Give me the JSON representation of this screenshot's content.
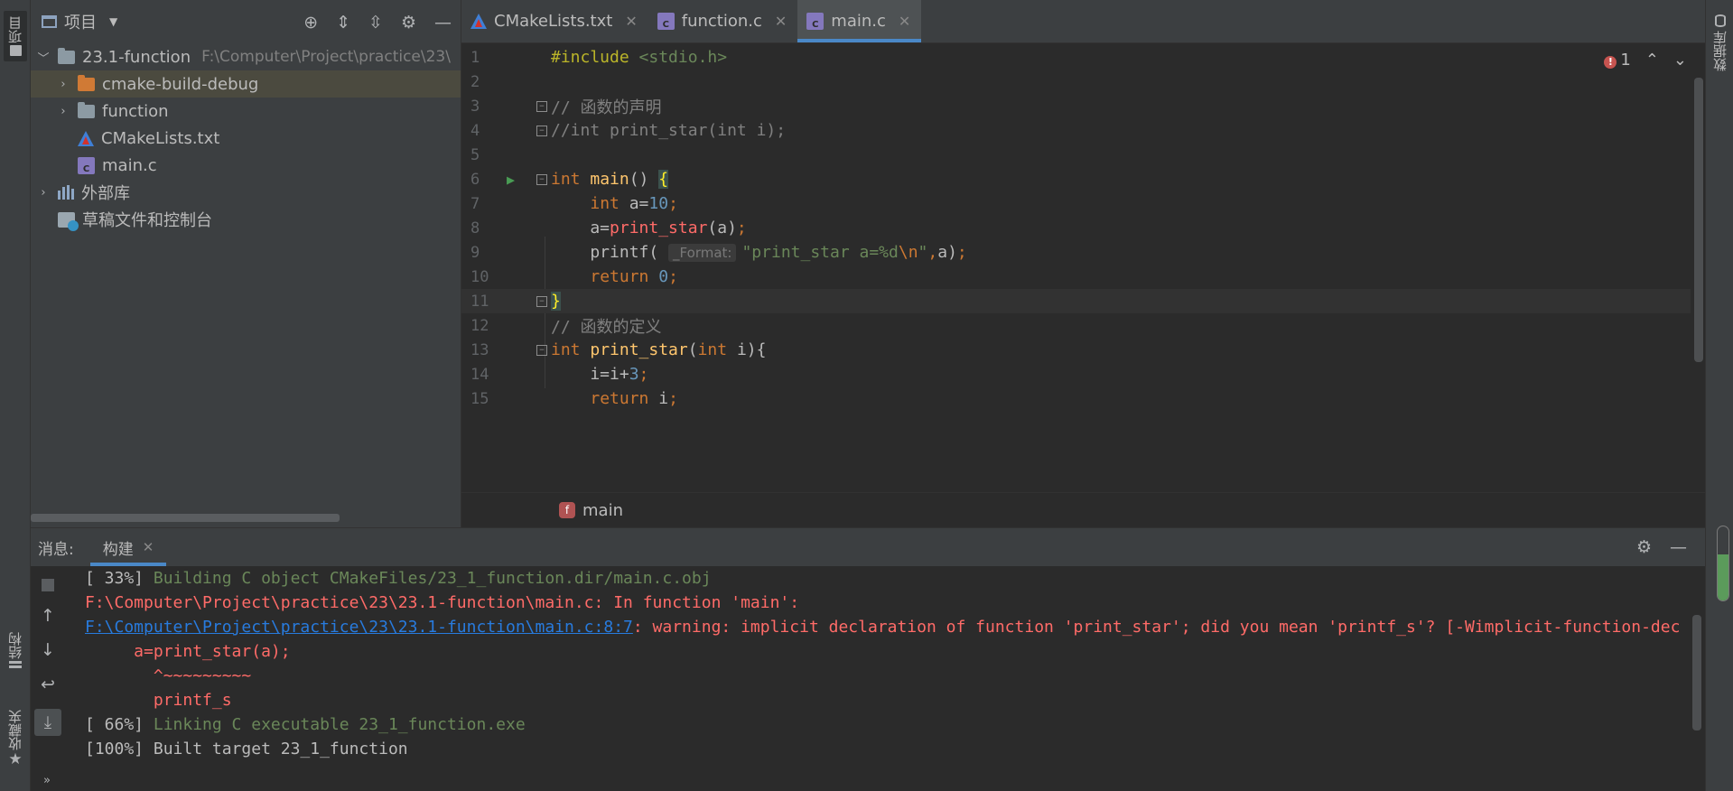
{
  "left_strip": {
    "project_tab": "项目",
    "structure_tab": "结构",
    "favorites_tab": "收藏夹"
  },
  "right_strip": {
    "database_tab": "数据库"
  },
  "project_panel": {
    "title": "项目",
    "tree": [
      {
        "label": "23.1-function",
        "path": "F:\\Computer\\Project\\practice\\23\\",
        "type": "folder",
        "expanded": true,
        "depth": 0
      },
      {
        "label": "cmake-build-debug",
        "type": "folder-orange",
        "expanded": false,
        "depth": 1,
        "selected": true
      },
      {
        "label": "function",
        "type": "folder",
        "expanded": false,
        "depth": 1
      },
      {
        "label": "CMakeLists.txt",
        "type": "cmake",
        "depth": 1
      },
      {
        "label": "main.c",
        "type": "c",
        "depth": 1
      },
      {
        "label": "外部库",
        "type": "lib",
        "expanded": false,
        "depth": 0
      },
      {
        "label": "草稿文件和控制台",
        "type": "scratch",
        "depth": 0
      }
    ]
  },
  "tabs": [
    {
      "label": "CMakeLists.txt",
      "icon": "cmake-icon",
      "active": false
    },
    {
      "label": "function.c",
      "icon": "c-file-icon",
      "active": false
    },
    {
      "label": "main.c",
      "icon": "c-file-icon",
      "active": true
    }
  ],
  "editor": {
    "error_count": "1",
    "lines": [
      {
        "n": "1",
        "html_parts": [
          [
            "dir",
            "#include "
          ],
          [
            "hdr",
            "<stdio.h>"
          ]
        ]
      },
      {
        "n": "2",
        "html_parts": []
      },
      {
        "n": "3",
        "fold": true,
        "html_parts": [
          [
            "cmt",
            "// 函数的声明"
          ]
        ]
      },
      {
        "n": "4",
        "fold": true,
        "html_parts": [
          [
            "cmt",
            "//int print_star(int i);"
          ]
        ]
      },
      {
        "n": "5",
        "html_parts": []
      },
      {
        "n": "6",
        "run": true,
        "fold": true,
        "html_parts": [
          [
            "kw",
            "int "
          ],
          [
            "fn",
            "main"
          ],
          [
            "plain",
            "() "
          ],
          [
            "brace",
            "{"
          ]
        ]
      },
      {
        "n": "7",
        "html_parts": [
          [
            "plain",
            "    "
          ],
          [
            "kw",
            "int "
          ],
          [
            "plain",
            "a="
          ],
          [
            "num",
            "10"
          ],
          [
            "kw",
            ";"
          ]
        ]
      },
      {
        "n": "8",
        "html_parts": [
          [
            "plain",
            "    a="
          ],
          [
            "err",
            "print_star"
          ],
          [
            "plain",
            "(a)"
          ],
          [
            "kw",
            ";"
          ]
        ]
      },
      {
        "n": "9",
        "html_parts": [
          [
            "plain",
            "    printf( "
          ],
          [
            "hint",
            "_Format:"
          ],
          [
            "str",
            "\"print_star a=%d"
          ],
          [
            "kw",
            "\\n"
          ],
          [
            "str",
            "\""
          ],
          [
            "kw",
            ","
          ],
          [
            "plain",
            "a)"
          ],
          [
            "kw",
            ";"
          ]
        ]
      },
      {
        "n": "10",
        "html_parts": [
          [
            "plain",
            "    "
          ],
          [
            "kw",
            "return "
          ],
          [
            "num",
            "0"
          ],
          [
            "kw",
            ";"
          ]
        ]
      },
      {
        "n": "11",
        "fold": true,
        "current": true,
        "html_parts": [
          [
            "brace",
            "}"
          ]
        ]
      },
      {
        "n": "12",
        "html_parts": [
          [
            "cmt",
            "// 函数的定义"
          ]
        ]
      },
      {
        "n": "13",
        "fold": true,
        "html_parts": [
          [
            "kw",
            "int "
          ],
          [
            "fn",
            "print_star"
          ],
          [
            "plain",
            "("
          ],
          [
            "kw",
            "int "
          ],
          [
            "plain",
            "i){"
          ]
        ]
      },
      {
        "n": "14",
        "html_parts": [
          [
            "plain",
            "    i=i+"
          ],
          [
            "num",
            "3"
          ],
          [
            "kw",
            ";"
          ]
        ]
      },
      {
        "n": "15",
        "html_parts": [
          [
            "plain",
            "    "
          ],
          [
            "kw",
            "return "
          ],
          [
            "plain",
            "i"
          ],
          [
            "kw",
            ";"
          ]
        ]
      }
    ],
    "breadcrumb": "main"
  },
  "build": {
    "messages_label": "消息:",
    "tab_label": "构建",
    "lines": [
      {
        "parts": [
          [
            "b-plain",
            "[ 33%] "
          ],
          [
            "b-green",
            "Building C object CMakeFiles/23_1_function.dir/main.c.obj"
          ]
        ]
      },
      {
        "parts": [
          [
            "b-red",
            "F:\\Computer\\Project\\practice\\23\\23.1-function\\main.c: In function 'main':"
          ]
        ]
      },
      {
        "parts": [
          [
            "b-link",
            "F:\\Computer\\Project\\practice\\23\\23.1-function\\main.c:8:7"
          ],
          [
            "b-red",
            ": warning: implicit declaration of function 'print_star'; did you mean 'printf_s'? [-Wimplicit-function-declaration]"
          ]
        ]
      },
      {
        "parts": [
          [
            "b-red",
            "     a=print_star(a);"
          ]
        ]
      },
      {
        "parts": [
          [
            "b-red",
            "       ^~~~~~~~~~"
          ]
        ]
      },
      {
        "parts": [
          [
            "b-red",
            "       printf_s"
          ]
        ]
      },
      {
        "parts": [
          [
            "b-plain",
            "[ 66%] "
          ],
          [
            "b-green",
            "Linking C executable 23_1_function.exe"
          ]
        ]
      },
      {
        "parts": [
          [
            "b-plain",
            "[100%] Built target 23_1_function"
          ]
        ]
      }
    ]
  }
}
